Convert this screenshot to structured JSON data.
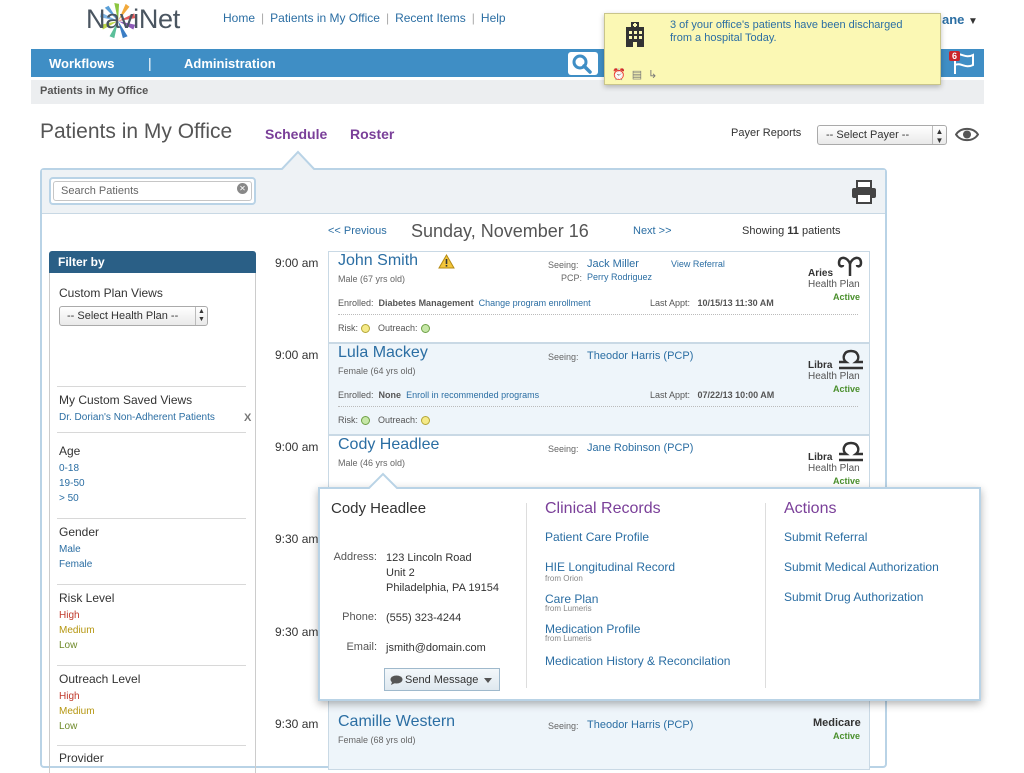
{
  "brand": {
    "name": "NaviNet"
  },
  "toplinks": [
    "Home",
    "Patients in My Office",
    "Recent Items",
    "Help"
  ],
  "user": {
    "name_fragment": "ane"
  },
  "nav": {
    "workflows": "Workflows",
    "separator": "|",
    "administration": "Administration",
    "notification_count": "6"
  },
  "breadcrumb": "Patients in My Office",
  "notification": {
    "text": "3 of your office's patients have been discharged from a hospital Today."
  },
  "page": {
    "title": "Patients in My Office",
    "tab_schedule": "Schedule",
    "tab_roster": "Roster",
    "payer_label": "Payer Reports",
    "payer_select": "-- Select Payer --",
    "search_placeholder": "Search Patients"
  },
  "schedule": {
    "prev": "<< Previous",
    "date": "Sunday, November 16",
    "next": "Next >>",
    "showing_prefix": "Showing",
    "showing_count": "11",
    "showing_suffix": "patients"
  },
  "filter": {
    "header": "Filter by",
    "custom_plan_views": "Custom Plan Views",
    "health_plan_select": "-- Select Health Plan --",
    "saved_views_title": "My Custom Saved Views",
    "saved_view": "Dr. Dorian's Non-Adherent Patients",
    "saved_view_remove": "X",
    "age_title": "Age",
    "age": [
      "0-18",
      "19-50",
      "> 50"
    ],
    "gender_title": "Gender",
    "gender": [
      "Male",
      "Female"
    ],
    "risk_title": "Risk Level",
    "risk": [
      "High",
      "Medium",
      "Low"
    ],
    "outreach_title": "Outreach Level",
    "outreach": [
      "High",
      "Medium",
      "Low"
    ],
    "provider_title": "Provider",
    "level_colors": {
      "high": "#c0392b",
      "medium": "#b5960f",
      "low": "#6f8a2a"
    }
  },
  "labels": {
    "seeing": "Seeing:",
    "pcp": "PCP:",
    "view_referral": "View Referral",
    "enrolled": "Enrolled:",
    "last_appt": "Last Appt:",
    "risk": "Risk:",
    "outreach": "Outreach:",
    "active": "Active",
    "health_plan": "Health Plan"
  },
  "appointments": [
    {
      "time": "9:00 am",
      "name": "John Smith",
      "meta": "Male (67 yrs old)",
      "seeing": "Jack Miller",
      "pcp": "Perry Rodriguez",
      "enrolled": "Diabetes Management",
      "enroll_link": "Change program enrollment",
      "last_appt": "10/15/13 11:30 AM",
      "plan": "Aries"
    },
    {
      "time": "9:00 am",
      "name": "Lula Mackey",
      "meta": "Female (64 yrs old)",
      "seeing": "Theodor Harris (PCP)",
      "enrolled": "None",
      "enroll_link": "Enroll in recommended programs",
      "last_appt": "07/22/13 10:00 AM",
      "plan": "Libra"
    },
    {
      "time": "9:00 am",
      "name": "Cody Headlee",
      "meta": "Male (46 yrs old)",
      "seeing": "Jane Robinson (PCP)",
      "plan": "Libra"
    },
    {
      "time": "9:30 am"
    },
    {
      "time": "9:30 am"
    },
    {
      "time": "9:30 am",
      "name": "Camille Western",
      "meta": "Female (68 yrs old)",
      "seeing": "Theodor Harris (PCP)",
      "plan": "Medicare"
    }
  ],
  "popup": {
    "name": "Cody Headlee",
    "address_label": "Address:",
    "address": [
      "123 Lincoln Road",
      "Unit 2",
      "Philadelphia, PA 19154"
    ],
    "phone_label": "Phone:",
    "phone": "(555) 323-4244",
    "email_label": "Email:",
    "email": "jsmith@domain.com",
    "send_message": "Send Message",
    "clinical_title": "Clinical Records",
    "clinical": [
      {
        "label": "Patient Care Profile"
      },
      {
        "label": "HIE Longitudinal Record",
        "source": "from Orion"
      },
      {
        "label": "Care Plan",
        "source": "from Lumeris"
      },
      {
        "label": "Medication Profile",
        "source": "from Lumeris"
      },
      {
        "label": "Medication History & Reconcilation"
      }
    ],
    "actions_title": "Actions",
    "actions": [
      "Submit Referral",
      "Submit Medical Authorization",
      "Submit Drug Authorization"
    ]
  },
  "colors": {
    "nav": "#3f8ec5",
    "link": "#2b6ea3",
    "tab": "#7a3f99",
    "filter_header": "#2a5f86",
    "notification_bg": "#fbf8b4",
    "active": "#4a8f2c"
  }
}
